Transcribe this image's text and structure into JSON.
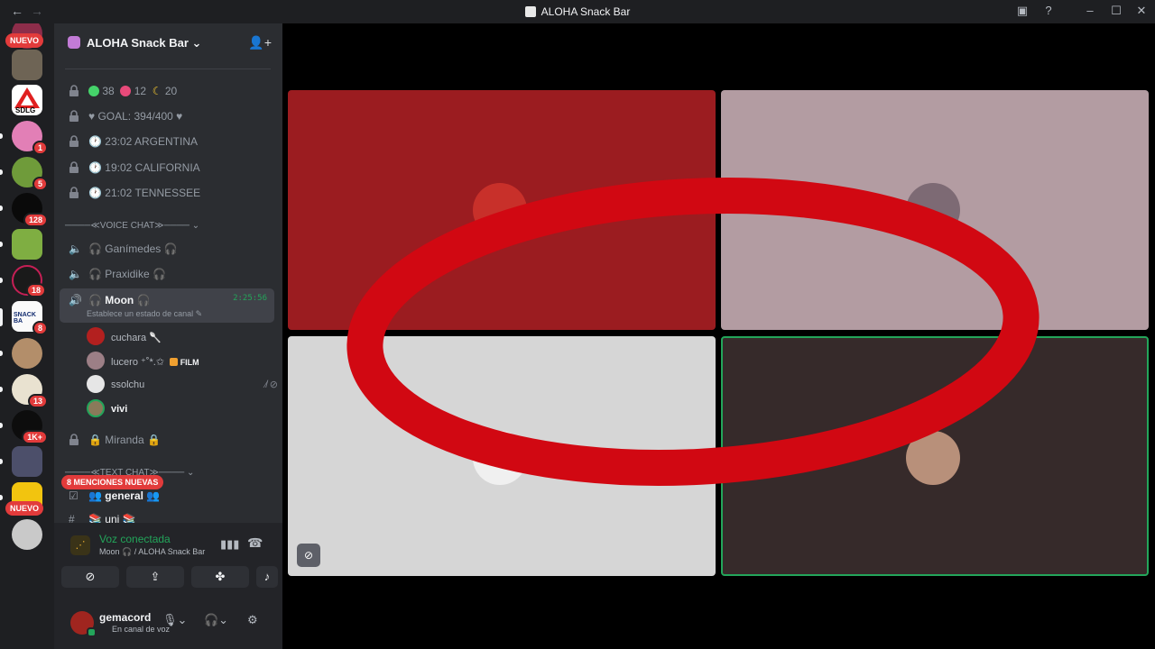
{
  "titlebar": {
    "title": "ALOHA Snack Bar",
    "back_icon": "←",
    "forward_icon": "→"
  },
  "guilds": {
    "nuevo_top": "NUEVO",
    "nuevo_bottom": "NUEVO",
    "badges": [
      "1",
      "5",
      "128",
      "18",
      "8",
      "13",
      "1K+"
    ],
    "sdlg_label": "SDLG",
    "snackbar_label": "SNACK BA"
  },
  "server": {
    "name": "ALOHA Snack Bar"
  },
  "channels": {
    "stats": {
      "green": "38",
      "red": "12",
      "moon": "20"
    },
    "goal": "♥ GOAL: 394/400 ♥",
    "clock1": "23:02 ARGENTINA",
    "clock2": "19:02 CALIFORNIA",
    "clock3": "21:02 TENNESSEE",
    "voice_category": "────≪VOICE CHAT≫────",
    "voice": [
      {
        "label": "🎧 Ganímedes 🎧"
      },
      {
        "label": "🎧 Praxidike 🎧"
      },
      {
        "label": "🎧 Moon 🎧",
        "time": "2:25:56",
        "sub": "Establece un estado de canal ✎"
      }
    ],
    "voice_users": [
      {
        "name": "cuchara 🥄"
      },
      {
        "name": "lucero ⁺˚*.✩"
      },
      {
        "name": "ssolchu"
      },
      {
        "name": "vivi"
      }
    ],
    "film_tag": "FILM",
    "miranda": "🔒 Miranda 🔒",
    "text_category": "────≪TEXT CHAT≫────",
    "general": "👥 general 👥",
    "uni": "📚 uni 📚"
  },
  "mentions": "8 MENCIONES NUEVAS",
  "voice_panel": {
    "title": "Voz conectada",
    "subtitle": "Moon 🎧 / ALOHA Snack Bar"
  },
  "user": {
    "name": "gemacord",
    "status": "En canal de voz"
  },
  "colors": {
    "tile1": "#9b1c20",
    "tile2": "#b39ca2",
    "tile3": "#d6d6d6",
    "tile4": "#362a2a",
    "ring": "#d10812",
    "speaking": "#23a55a"
  }
}
